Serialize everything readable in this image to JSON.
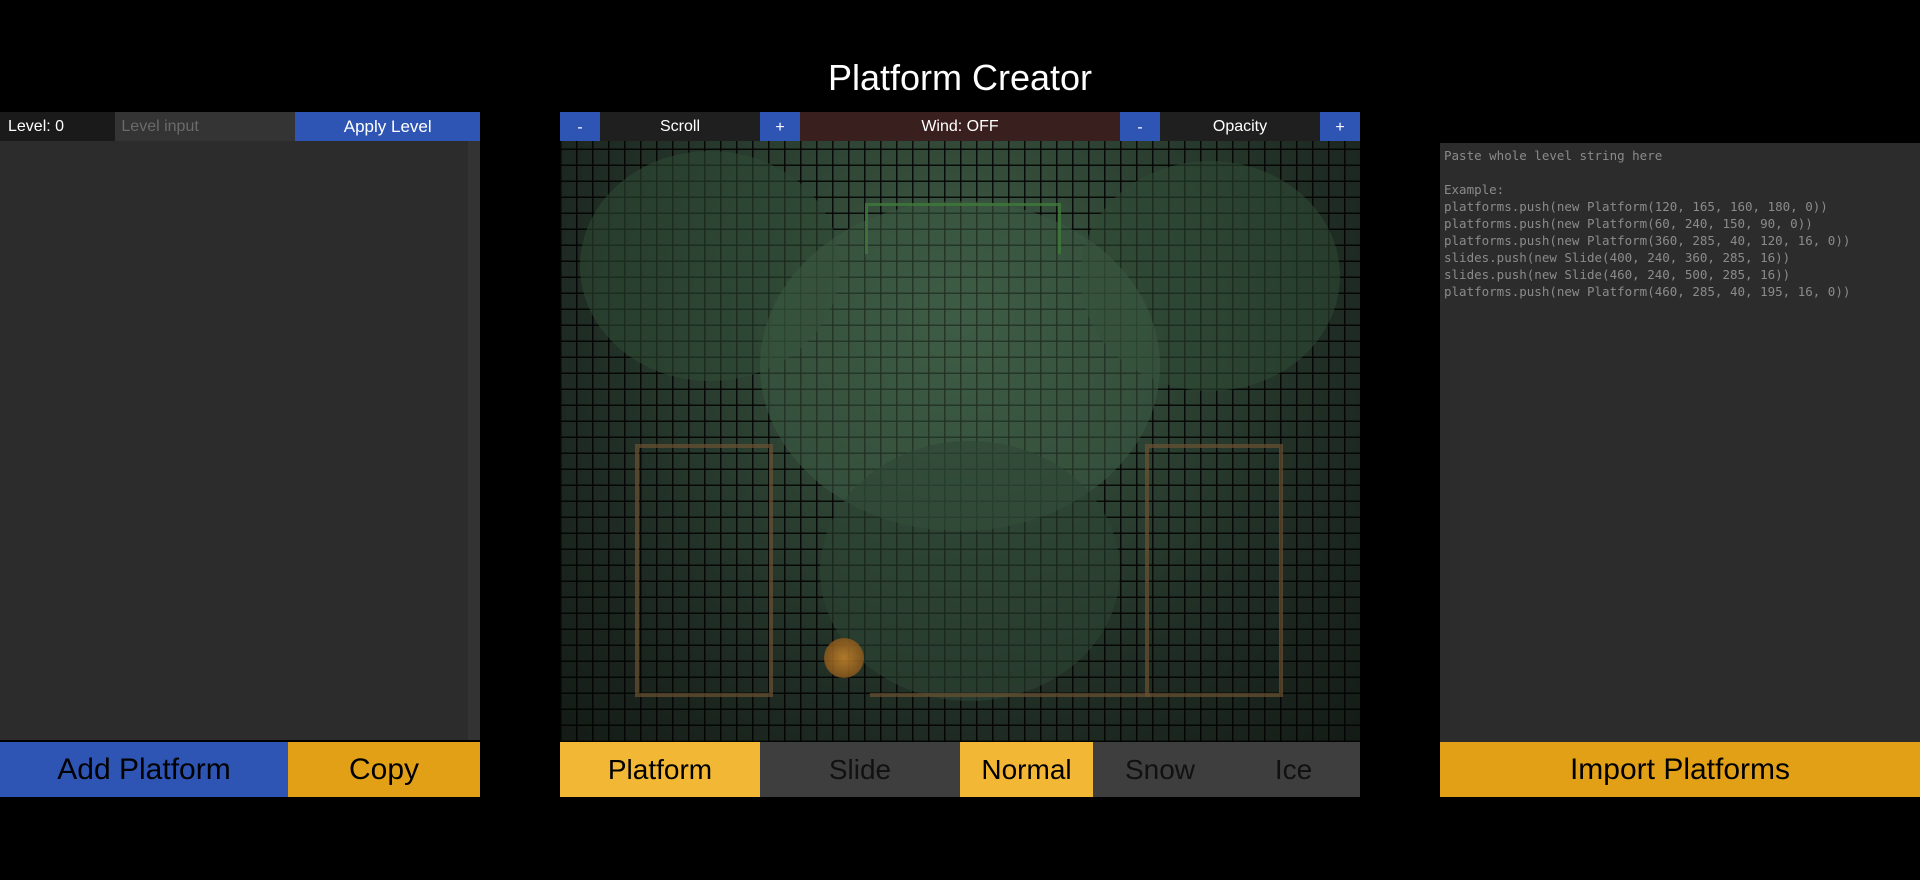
{
  "app": {
    "title": "Platform Creator"
  },
  "left_panel": {
    "level_label": "Level: 0",
    "level_input_placeholder": "Level input",
    "apply_label": "Apply Level",
    "add_platform_label": "Add Platform",
    "copy_label": "Copy"
  },
  "center_panel": {
    "scroll_minus": "-",
    "scroll_label": "Scroll",
    "scroll_plus": "+",
    "wind_label": "Wind: OFF",
    "opacity_minus": "-",
    "opacity_label": "Opacity",
    "opacity_plus": "+",
    "tabs": {
      "platform": "Platform",
      "slide": "Slide",
      "normal": "Normal",
      "snow": "Snow",
      "ice": "Ice"
    },
    "active_type": "Platform",
    "active_surface": "Normal"
  },
  "right_panel": {
    "textarea_placeholder": "Paste whole level string here\n\nExample:\nplatforms.push(new Platform(120, 165, 160, 180, 0))\nplatforms.push(new Platform(60, 240, 150, 90, 0))\nplatforms.push(new Platform(360, 285, 40, 120, 16, 0))\nslides.push(new Slide(400, 240, 360, 285, 16))\nslides.push(new Slide(460, 240, 500, 285, 16))\nplatforms.push(new Platform(460, 285, 40, 195, 16, 0))",
    "import_label": "Import Platforms"
  },
  "colors": {
    "blue_button": "#2e55b3",
    "orange_button": "#e2a017",
    "yellow_active": "#f2b735",
    "panel_bg": "#2c2c2c",
    "wind_bg": "#3a1f1f"
  }
}
